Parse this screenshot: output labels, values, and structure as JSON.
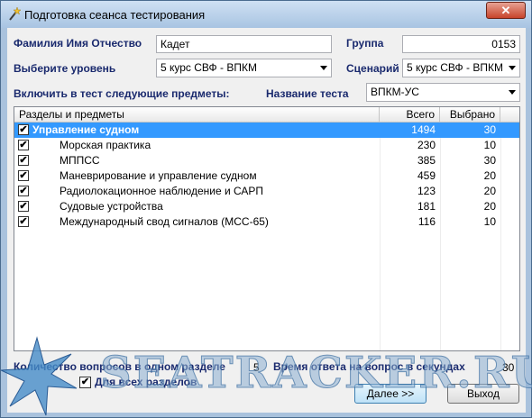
{
  "window": {
    "title": "Подготовка сеанса тестирования",
    "close_label": "✕"
  },
  "form": {
    "fio_label": "Фамилия Имя Отчество",
    "fio_value": "Кадет",
    "group_label": "Группа",
    "group_value": "0153",
    "level_label": "Выберите уровень",
    "level_value": "5 курс СВФ - ВПКМ",
    "scenario_label": "Сценарий",
    "scenario_value": "5 курс СВФ - ВПКМ",
    "include_label": "Включить в тест следующие предметы:",
    "test_name_label": "Название теста",
    "test_name_value": "ВПКМ-УС"
  },
  "grid": {
    "columns": [
      "Разделы и предметы",
      "Всего",
      "Выбрано"
    ],
    "rows": [
      {
        "name": "Управление судном",
        "total": "1494",
        "selected": "30",
        "checked": true,
        "section": true
      },
      {
        "name": "Морская практика",
        "total": "230",
        "selected": "10",
        "checked": true,
        "section": false
      },
      {
        "name": "МППСС",
        "total": "385",
        "selected": "30",
        "checked": true,
        "section": false
      },
      {
        "name": "Маневрирование и управление судном",
        "total": "459",
        "selected": "20",
        "checked": true,
        "section": false
      },
      {
        "name": "Радиолокационное наблюдение и САРП",
        "total": "123",
        "selected": "20",
        "checked": true,
        "section": false
      },
      {
        "name": "Судовые устройства",
        "total": "181",
        "selected": "20",
        "checked": true,
        "section": false
      },
      {
        "name": "Международный свод сигналов (МСС-65)",
        "total": "116",
        "selected": "10",
        "checked": true,
        "section": false
      }
    ]
  },
  "bottom": {
    "questions_label": "Количество вопросов в одном разделе",
    "questions_value": "5",
    "time_label": "Время ответа на вопрос в секундах",
    "time_value": "30",
    "all_sections_label": "Для всех разделов",
    "all_sections_checked": true,
    "next_label": "Далее >>",
    "exit_label": "Выход"
  },
  "watermark": {
    "text": "SEATRACKER.RU"
  },
  "colors": {
    "accent": "#3399ff",
    "label": "#1a2a6e"
  }
}
